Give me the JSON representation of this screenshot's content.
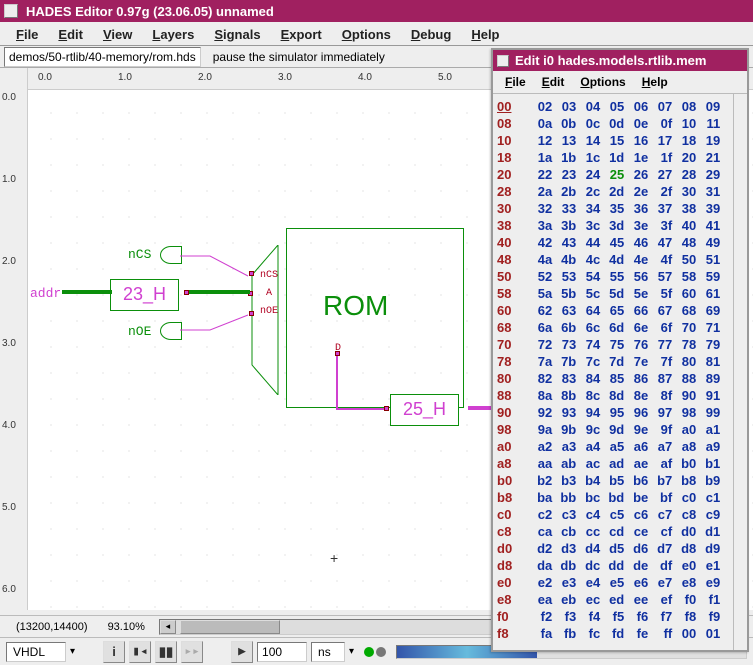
{
  "window": {
    "title": "HADES Editor 0.97g (23.06.05)    unnamed"
  },
  "menus": [
    "File",
    "Edit",
    "View",
    "Layers",
    "Signals",
    "Export",
    "Options",
    "Debug",
    "Help"
  ],
  "subbar": {
    "file": "demos/50-rtlib/40-memory/rom.hds",
    "message": "pause the simulator immediately"
  },
  "ruler_h": [
    "0.0",
    "1.0",
    "2.0",
    "3.0",
    "4.0",
    "5.0"
  ],
  "ruler_v": [
    "0.0",
    "1.0",
    "2.0",
    "3.0",
    "4.0",
    "5.0",
    "6.0"
  ],
  "schematic": {
    "rom_label": "ROM",
    "addr_label": "addr",
    "ncs_label": "nCS",
    "noe_label": "nOE",
    "pin_ncs": "nCS",
    "pin_a": "A",
    "pin_noe": "nOE",
    "pin_d": "D",
    "addr_value": "23_H",
    "data_value": "25_H"
  },
  "status": {
    "coord": "(13200,14400)",
    "zoom": "93.10%"
  },
  "controls": {
    "lang": "VHDL",
    "step": "100",
    "unit": "ns"
  },
  "mem": {
    "title": "Edit i0 hades.models.rtlib.mem",
    "menus": [
      "File",
      "Edit",
      "Options",
      "Help"
    ],
    "highlight_addr": "00",
    "highlight_cell": "25",
    "rows": [
      {
        "a": "00",
        "c": [
          "02",
          "03",
          "04",
          "05",
          "06",
          "07",
          "08",
          "09"
        ]
      },
      {
        "a": "08",
        "c": [
          "0a",
          "0b",
          "0c",
          "0d",
          "0e",
          "0f",
          "10",
          "11"
        ]
      },
      {
        "a": "10",
        "c": [
          "12",
          "13",
          "14",
          "15",
          "16",
          "17",
          "18",
          "19"
        ]
      },
      {
        "a": "18",
        "c": [
          "1a",
          "1b",
          "1c",
          "1d",
          "1e",
          "1f",
          "20",
          "21"
        ]
      },
      {
        "a": "20",
        "c": [
          "22",
          "23",
          "24",
          "25",
          "26",
          "27",
          "28",
          "29"
        ]
      },
      {
        "a": "28",
        "c": [
          "2a",
          "2b",
          "2c",
          "2d",
          "2e",
          "2f",
          "30",
          "31"
        ]
      },
      {
        "a": "30",
        "c": [
          "32",
          "33",
          "34",
          "35",
          "36",
          "37",
          "38",
          "39"
        ]
      },
      {
        "a": "38",
        "c": [
          "3a",
          "3b",
          "3c",
          "3d",
          "3e",
          "3f",
          "40",
          "41"
        ]
      },
      {
        "a": "40",
        "c": [
          "42",
          "43",
          "44",
          "45",
          "46",
          "47",
          "48",
          "49"
        ]
      },
      {
        "a": "48",
        "c": [
          "4a",
          "4b",
          "4c",
          "4d",
          "4e",
          "4f",
          "50",
          "51"
        ]
      },
      {
        "a": "50",
        "c": [
          "52",
          "53",
          "54",
          "55",
          "56",
          "57",
          "58",
          "59"
        ]
      },
      {
        "a": "58",
        "c": [
          "5a",
          "5b",
          "5c",
          "5d",
          "5e",
          "5f",
          "60",
          "61"
        ]
      },
      {
        "a": "60",
        "c": [
          "62",
          "63",
          "64",
          "65",
          "66",
          "67",
          "68",
          "69"
        ]
      },
      {
        "a": "68",
        "c": [
          "6a",
          "6b",
          "6c",
          "6d",
          "6e",
          "6f",
          "70",
          "71"
        ]
      },
      {
        "a": "70",
        "c": [
          "72",
          "73",
          "74",
          "75",
          "76",
          "77",
          "78",
          "79"
        ]
      },
      {
        "a": "78",
        "c": [
          "7a",
          "7b",
          "7c",
          "7d",
          "7e",
          "7f",
          "80",
          "81"
        ]
      },
      {
        "a": "80",
        "c": [
          "82",
          "83",
          "84",
          "85",
          "86",
          "87",
          "88",
          "89"
        ]
      },
      {
        "a": "88",
        "c": [
          "8a",
          "8b",
          "8c",
          "8d",
          "8e",
          "8f",
          "90",
          "91"
        ]
      },
      {
        "a": "90",
        "c": [
          "92",
          "93",
          "94",
          "95",
          "96",
          "97",
          "98",
          "99"
        ]
      },
      {
        "a": "98",
        "c": [
          "9a",
          "9b",
          "9c",
          "9d",
          "9e",
          "9f",
          "a0",
          "a1"
        ]
      },
      {
        "a": "a0",
        "c": [
          "a2",
          "a3",
          "a4",
          "a5",
          "a6",
          "a7",
          "a8",
          "a9"
        ]
      },
      {
        "a": "a8",
        "c": [
          "aa",
          "ab",
          "ac",
          "ad",
          "ae",
          "af",
          "b0",
          "b1"
        ]
      },
      {
        "a": "b0",
        "c": [
          "b2",
          "b3",
          "b4",
          "b5",
          "b6",
          "b7",
          "b8",
          "b9"
        ]
      },
      {
        "a": "b8",
        "c": [
          "ba",
          "bb",
          "bc",
          "bd",
          "be",
          "bf",
          "c0",
          "c1"
        ]
      },
      {
        "a": "c0",
        "c": [
          "c2",
          "c3",
          "c4",
          "c5",
          "c6",
          "c7",
          "c8",
          "c9"
        ]
      },
      {
        "a": "c8",
        "c": [
          "ca",
          "cb",
          "cc",
          "cd",
          "ce",
          "cf",
          "d0",
          "d1"
        ]
      },
      {
        "a": "d0",
        "c": [
          "d2",
          "d3",
          "d4",
          "d5",
          "d6",
          "d7",
          "d8",
          "d9"
        ]
      },
      {
        "a": "d8",
        "c": [
          "da",
          "db",
          "dc",
          "dd",
          "de",
          "df",
          "e0",
          "e1"
        ]
      },
      {
        "a": "e0",
        "c": [
          "e2",
          "e3",
          "e4",
          "e5",
          "e6",
          "e7",
          "e8",
          "e9"
        ]
      },
      {
        "a": "e8",
        "c": [
          "ea",
          "eb",
          "ec",
          "ed",
          "ee",
          "ef",
          "f0",
          "f1"
        ]
      },
      {
        "a": "f0",
        "c": [
          "f2",
          "f3",
          "f4",
          "f5",
          "f6",
          "f7",
          "f8",
          "f9"
        ]
      },
      {
        "a": "f8",
        "c": [
          "fa",
          "fb",
          "fc",
          "fd",
          "fe",
          "ff",
          "00",
          "01"
        ]
      }
    ]
  }
}
